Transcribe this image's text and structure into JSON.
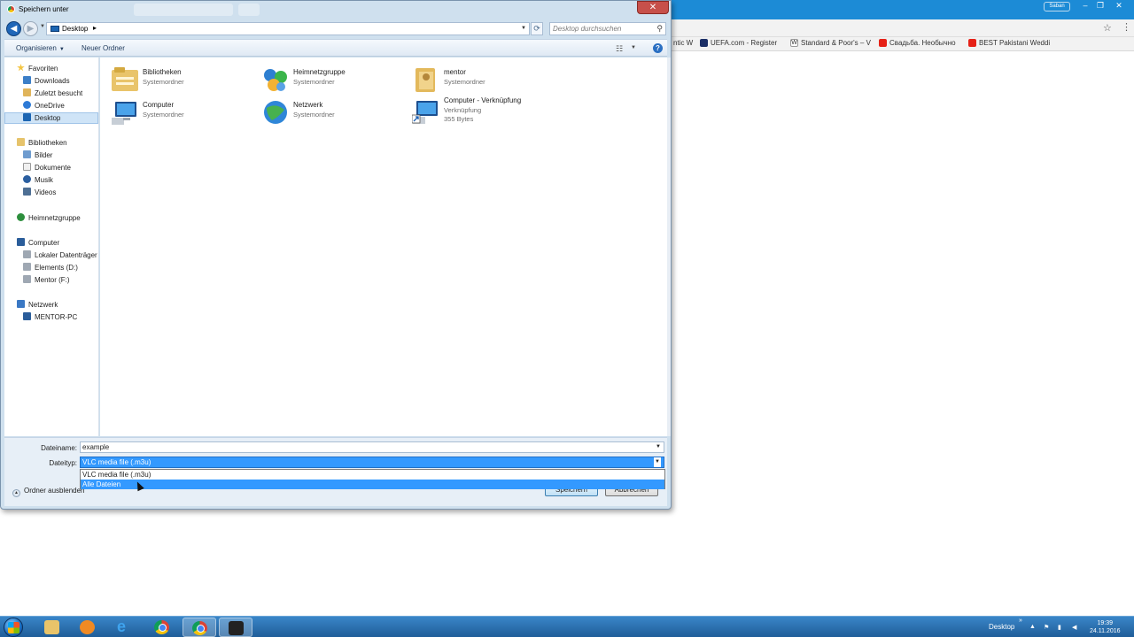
{
  "browser": {
    "user_badge": "Saban",
    "bookmarks": [
      {
        "label": "ntic W",
        "icon": "page-icon"
      },
      {
        "label": "UEFA.com - Register",
        "icon": "uefa-icon"
      },
      {
        "label": "Standard & Poor's – V",
        "icon": "wikipedia-icon"
      },
      {
        "label": "Свадьба. Необычно",
        "icon": "youtube-icon"
      },
      {
        "label": "BEST Pakistani Weddi",
        "icon": "youtube-icon"
      }
    ],
    "minimize_glyph": "–",
    "maximize_glyph": "❐",
    "close_glyph": "✕"
  },
  "dialog": {
    "title": "Speichern unter",
    "close_glyph": "✕",
    "address": {
      "location": "Desktop",
      "separator": "▸"
    },
    "search": {
      "placeholder": "Desktop durchsuchen"
    },
    "commands": {
      "organize": "Organisieren",
      "new_folder": "Neuer Ordner"
    },
    "nav_tree": {
      "favorites": {
        "label": "Favoriten",
        "items": [
          "Downloads",
          "Zuletzt besucht",
          "OneDrive",
          "Desktop"
        ]
      },
      "libraries": {
        "label": "Bibliotheken",
        "items": [
          "Bilder",
          "Dokumente",
          "Musik",
          "Videos"
        ]
      },
      "homegroup": {
        "label": "Heimnetzgruppe"
      },
      "computer": {
        "label": "Computer",
        "items": [
          "Lokaler Datenträger",
          "Elements (D:)",
          "Mentor (F:)"
        ]
      },
      "network": {
        "label": "Netzwerk",
        "items": [
          "MENTOR-PC"
        ]
      }
    },
    "files": [
      {
        "name": "Bibliotheken",
        "type": "Systemordner",
        "icon": "libraries-icon"
      },
      {
        "name": "Heimnetzgruppe",
        "type": "Systemordner",
        "icon": "homegroup-icon"
      },
      {
        "name": "mentor",
        "type": "Systemordner",
        "icon": "user-folder-icon"
      },
      {
        "name": "Computer",
        "type": "Systemordner",
        "icon": "computer-icon"
      },
      {
        "name": "Netzwerk",
        "type": "Systemordner",
        "icon": "network-icon"
      },
      {
        "name": "Computer - Verknüpfung",
        "type": "Verknüpfung",
        "size": "355 Bytes",
        "icon": "computer-shortcut-icon"
      }
    ],
    "form": {
      "filename_label": "Dateiname:",
      "filename_value": "example",
      "filetype_label": "Dateityp:",
      "filetype_value": "VLC media file (.m3u)",
      "filetype_options": [
        "VLC media file (.m3u)",
        "Alle Dateien"
      ],
      "highlighted_option": "Alle Dateien"
    },
    "hide_folders": "Ordner ausblenden",
    "save_button": "Speichern",
    "cancel_button": "Abbrechen"
  },
  "taskbar": {
    "tray_label": "Desktop",
    "time": "19:39",
    "date": "24.11.2016"
  }
}
